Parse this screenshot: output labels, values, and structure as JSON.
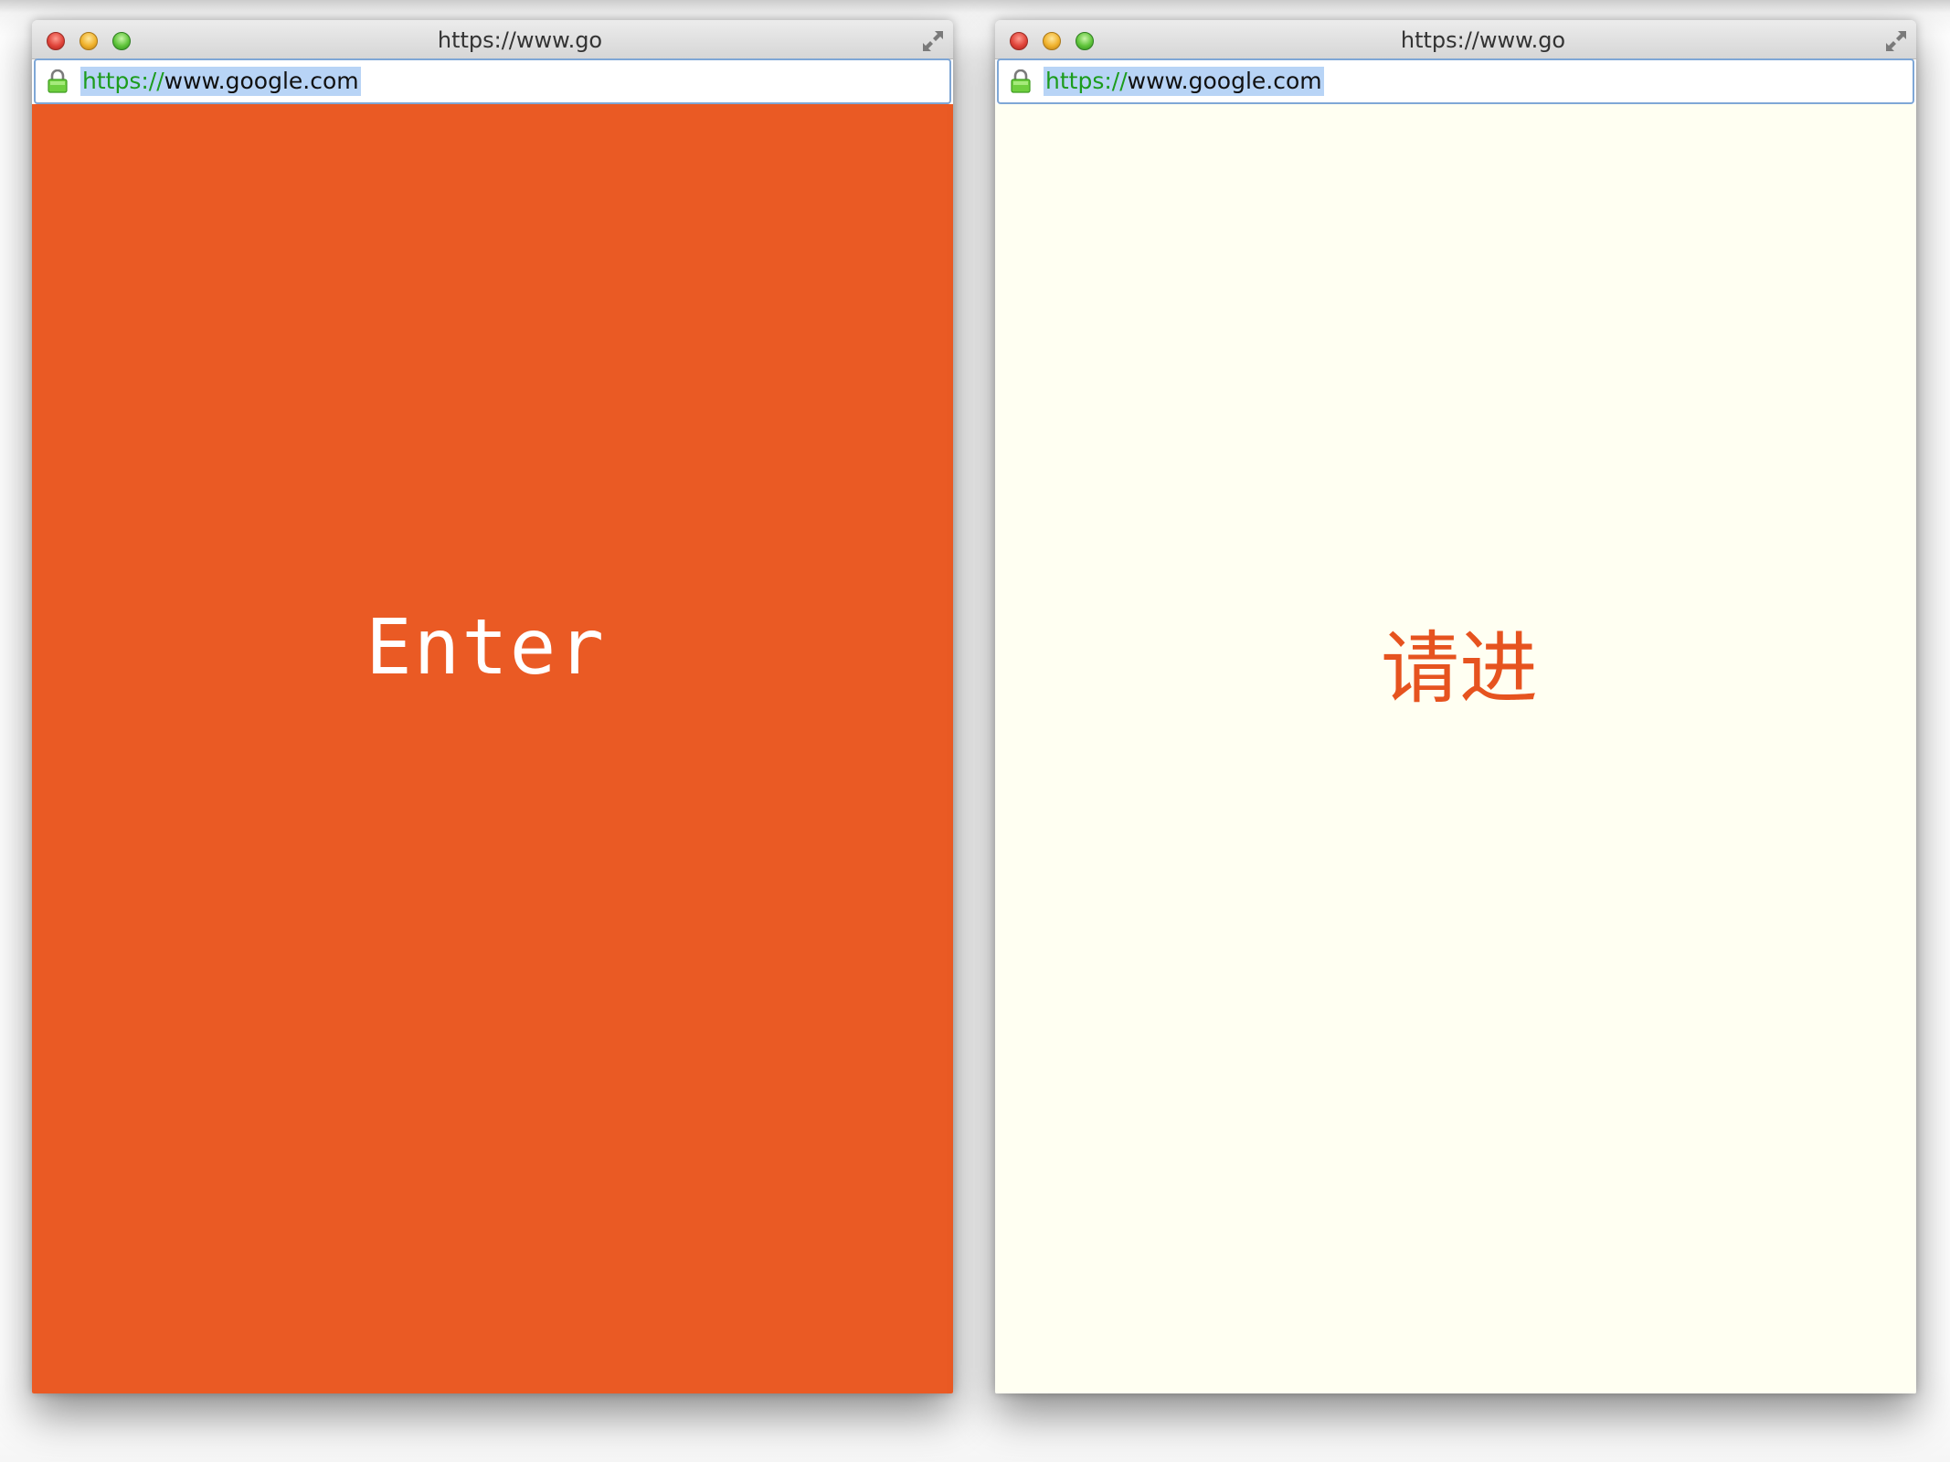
{
  "windows": [
    {
      "title": "https://www.go",
      "url": {
        "scheme": "https",
        "separator": "://",
        "host": "www.google.com"
      },
      "content_text": "Enter",
      "colors": {
        "background": "#ea5a24",
        "text": "#ffffff"
      }
    },
    {
      "title": "https://www.go",
      "url": {
        "scheme": "https",
        "separator": "://",
        "host": "www.google.com"
      },
      "content_text": "请进",
      "colors": {
        "background": "#fffff2",
        "text": "#e6531f"
      }
    }
  ],
  "icons": {
    "close": "close-button-icon",
    "minimize": "minimize-button-icon",
    "zoom": "zoom-button-icon",
    "fullscreen": "fullscreen-arrows-icon",
    "security": "padlock-icon"
  },
  "colors": {
    "url_scheme": "#1c9c1c",
    "url_selection": "#b8d4f6",
    "address_border": "#7fa7d6"
  }
}
